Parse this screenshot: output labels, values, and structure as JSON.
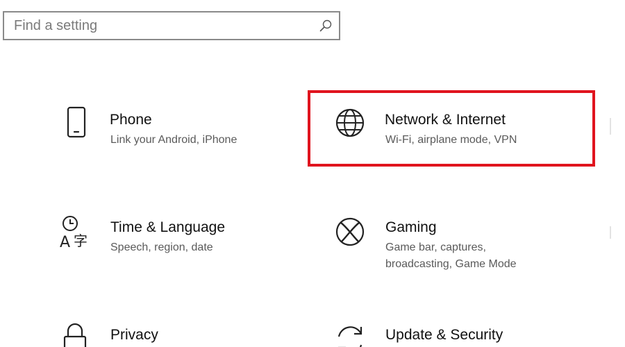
{
  "search": {
    "placeholder": "Find a setting",
    "value": ""
  },
  "tiles": [
    {
      "icon": "phone-icon",
      "title": "Phone",
      "description": [
        "Link your Android, iPhone"
      ]
    },
    {
      "icon": "globe-icon",
      "title": "Network & Internet",
      "description": [
        "Wi-Fi, airplane mode, VPN"
      ],
      "highlighted": true
    },
    {
      "icon": "time-language-icon",
      "title": "Time & Language",
      "description": [
        "Speech, region, date"
      ]
    },
    {
      "icon": "xbox-icon",
      "title": "Gaming",
      "description": [
        "Game bar, captures,",
        "broadcasting, Game Mode"
      ]
    },
    {
      "icon": "lock-icon",
      "title": "Privacy",
      "description": []
    },
    {
      "icon": "sync-icon",
      "title": "Update & Security",
      "description": []
    }
  ],
  "colors": {
    "highlight": "#e0141e",
    "title_text": "#111111",
    "description_text": "#5a5a5a"
  }
}
